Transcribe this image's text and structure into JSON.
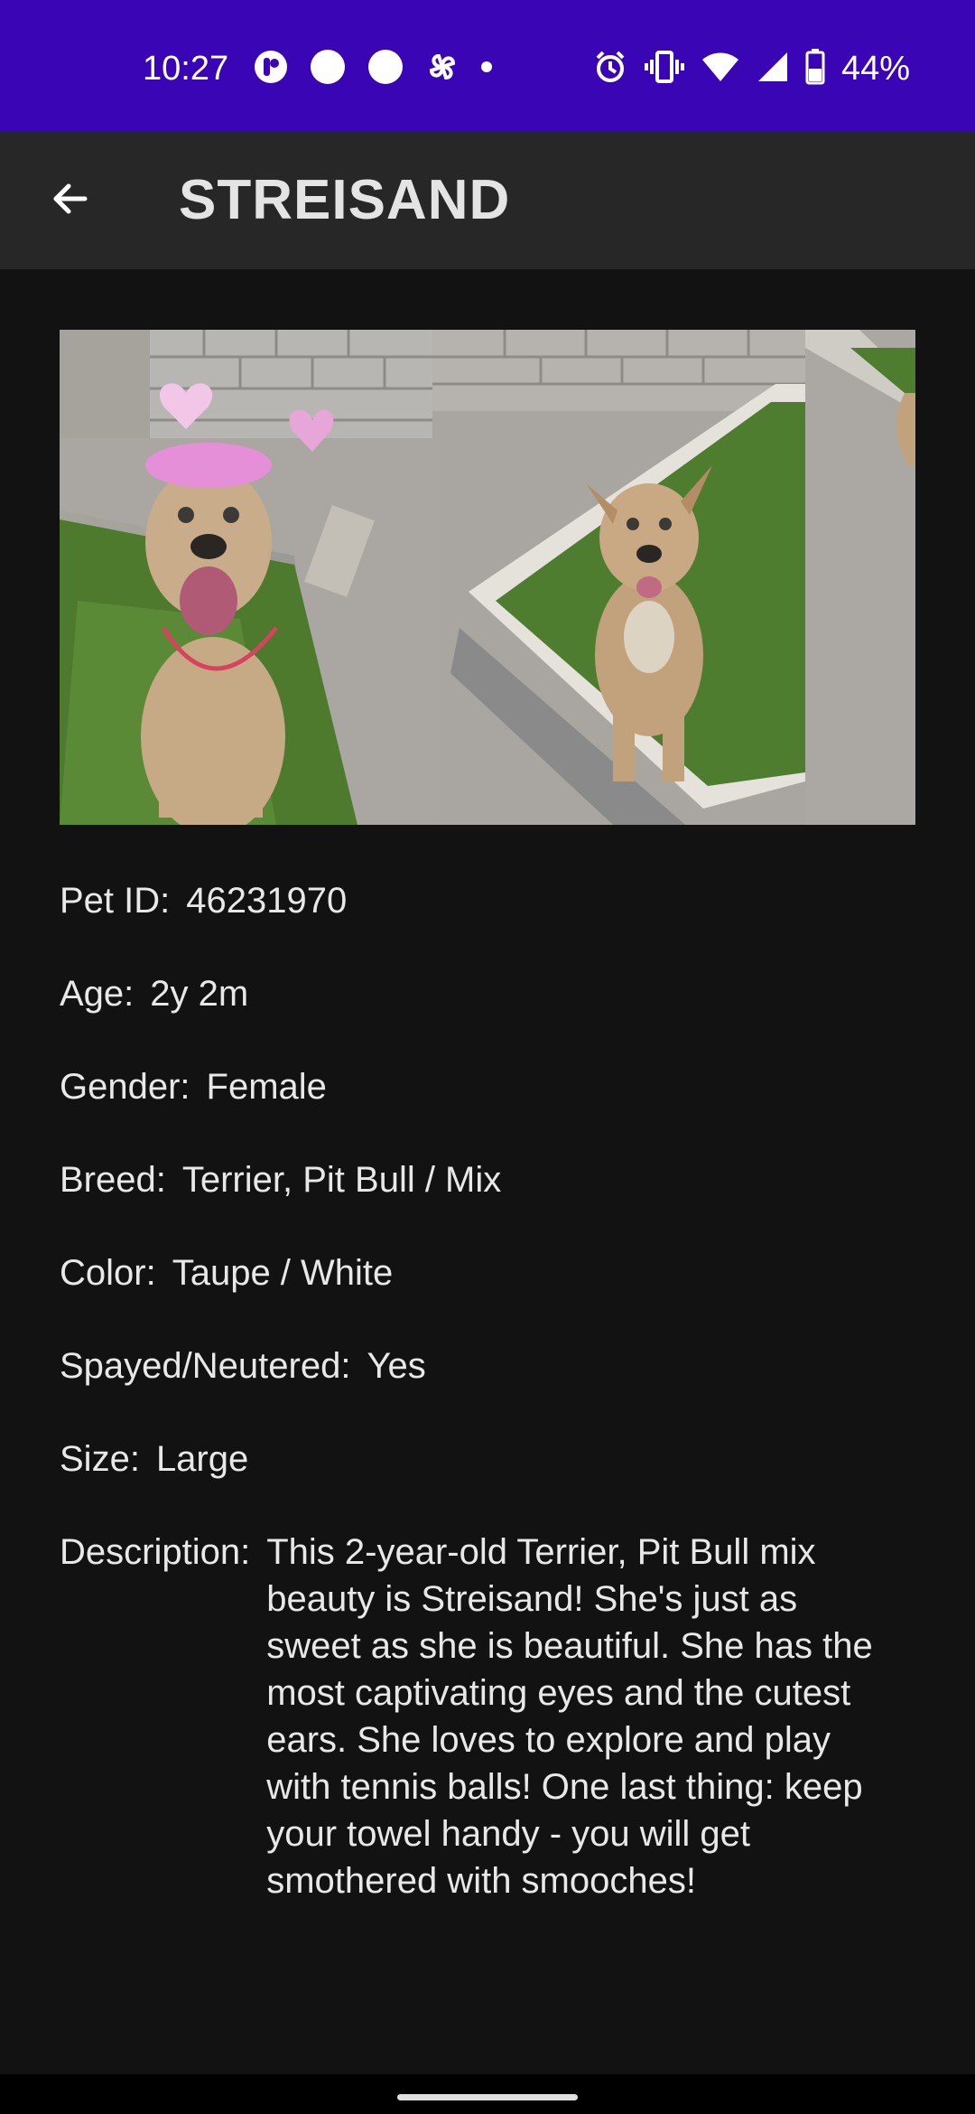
{
  "status_bar": {
    "time": "10:27",
    "battery": "44%",
    "background": "#3a06b5",
    "icons": [
      "app-notification-icon",
      "circle-notification-icon",
      "circle-notification-icon",
      "pinwheel-icon",
      "dot-icon",
      "alarm-icon",
      "vibrate-icon",
      "wifi-icon",
      "signal-icon",
      "battery-icon"
    ]
  },
  "app_bar": {
    "back_icon": "arrow-back-icon",
    "title": "STREISAND"
  },
  "photos": [
    "dog-photo-1",
    "dog-photo-2",
    "dog-photo-3"
  ],
  "details": [
    {
      "label": "Pet ID:",
      "value": "46231970"
    },
    {
      "label": "Age:",
      "value": "2y 2m"
    },
    {
      "label": "Gender:",
      "value": "Female"
    },
    {
      "label": "Breed:",
      "value": "Terrier, Pit Bull / Mix"
    },
    {
      "label": "Color:",
      "value": "Taupe / White"
    },
    {
      "label": "Spayed/Neutered:",
      "value": "Yes"
    },
    {
      "label": "Size:",
      "value": "Large"
    }
  ],
  "description": {
    "label": "Description:",
    "value": "This 2-year-old Terrier, Pit Bull mix beauty is Streisand! She's just as sweet as she is beautiful. She has the most captivating eyes and the cutest ears. She loves to explore and play with tennis balls! One last thing: keep your towel handy - you will get smothered with smooches!"
  }
}
